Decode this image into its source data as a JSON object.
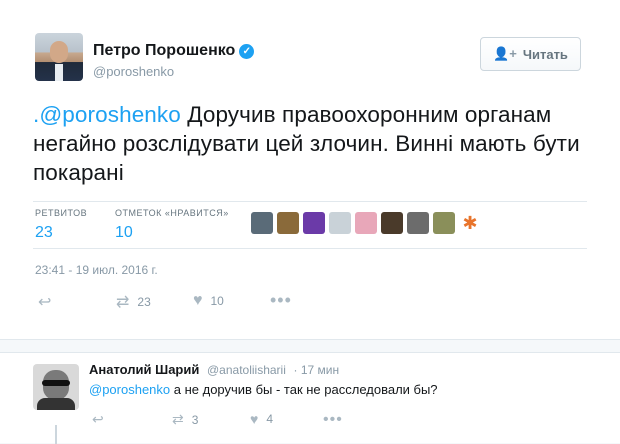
{
  "tweet": {
    "author_name": "Петро Порошенко",
    "author_handle": "@poroshenko",
    "follow_label": "Читать",
    "text_mention": ".@poroshenko",
    "text_body": " Доручив правоохоронним органам негайно розслідувати цей злочин. Винні мають бути покарані",
    "retweets_label": "РЕТВИТОВ",
    "retweets_count": "23",
    "likes_label": "ОТМЕТОК «НРАВИТСЯ»",
    "likes_count": "10",
    "timestamp": "23:41 - 19 июл. 2016 г.",
    "action_retweet_count": "23",
    "action_like_count": "10",
    "likers": [
      {
        "name": "liker-1",
        "color": "#5a6b78"
      },
      {
        "name": "liker-2",
        "color": "#8a6a3a"
      },
      {
        "name": "liker-3",
        "color": "#6b3aa8"
      },
      {
        "name": "liker-4",
        "color": "#c9d2d8"
      },
      {
        "name": "liker-5",
        "color": "#e8a7b9"
      },
      {
        "name": "liker-6",
        "color": "#4a3a2a"
      },
      {
        "name": "liker-7",
        "color": "#6c6c6c"
      },
      {
        "name": "liker-8",
        "color": "#8a8f5a"
      },
      {
        "name": "liker-9",
        "color": "#e8742b"
      }
    ]
  },
  "reply": {
    "author_name": "Анатолий Шарий",
    "author_handle": "@anatoliisharii",
    "age": "· 17 мин",
    "mention": "@poroshenko",
    "text": " а не доручив бы - так не расследовали бы?",
    "retweet_count": "3",
    "like_count": "4"
  },
  "colors": {
    "accent": "#1da1f2",
    "muted": "#8899a6"
  }
}
